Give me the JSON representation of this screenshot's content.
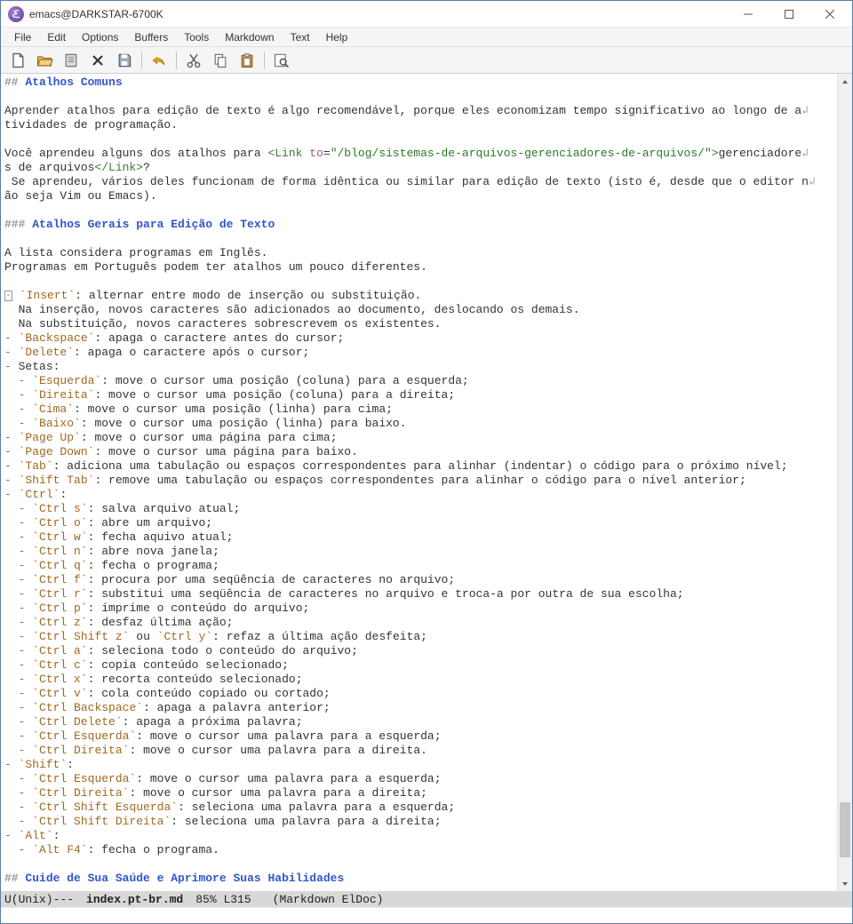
{
  "titlebar": {
    "title": "emacs@DARKSTAR-6700K"
  },
  "menubar": {
    "items": [
      "File",
      "Edit",
      "Options",
      "Buffers",
      "Tools",
      "Markdown",
      "Text",
      "Help"
    ]
  },
  "toolbar": {
    "buttons": [
      "new-file",
      "open-file",
      "open-dir",
      "close",
      "save",
      "sep",
      "undo",
      "sep",
      "cut",
      "copy",
      "paste",
      "sep",
      "search"
    ]
  },
  "modeline": {
    "coding": "U(Unix)---",
    "filename": "index.pt-br.md",
    "position": "85% L315",
    "mode": "(Markdown ElDoc)"
  },
  "doc": {
    "h1_hash": "##",
    "h1_text": "Atalhos Comuns",
    "p1a": "Aprender atalhos para edição de texto é algo recomendável, porque eles economizam tempo significativo ao longo de a",
    "p1b": "tividades de programação.",
    "p2_pre": "Você aprendeu alguns dos atalhos para ",
    "p2_tag_open": "<Link",
    "p2_attr_name": " to",
    "p2_eq": "=",
    "p2_attr_val": "\"/blog/sistemas-de-arquivos-gerenciadores-de-arquivos/\"",
    "p2_tag_close": ">",
    "p2_linktext": "gerenciadore",
    "p2b_pre": "s de arquivos",
    "p2b_tag": "</Link>",
    "p2b_post": "?",
    "p3a": " Se aprendeu, vários deles funcionam de forma idêntica ou similar para edição de texto (isto é, desde que o editor n",
    "p3b": "ão seja Vim ou Emacs).",
    "h2_hash": "###",
    "h2_text": "Atalhos Gerais para Edição de Texto",
    "p4": "A lista considera programas em Inglês.",
    "p5": "Programas em Português podem ter atalhos um pouco diferentes.",
    "li_insert_code": "Insert",
    "li_insert_rest": ": alternar entre modo de inserção ou substituição.",
    "li_insert_sub1": "  Na inserção, novos caracteres são adicionados ao documento, deslocando os demais.",
    "li_insert_sub2": "  Na substituição, novos caracteres sobrescrevem os existentes.",
    "li_bs_code": "Backspace",
    "li_bs_rest": ": apaga o caractere antes do cursor;",
    "li_del_code": "Delete",
    "li_del_rest": ": apaga o caractere após o cursor;",
    "li_arrows": "Setas:",
    "arrow_left_code": "Esquerda",
    "arrow_left_rest": ": move o cursor uma posição (coluna) para a esquerda;",
    "arrow_right_code": "Direita",
    "arrow_right_rest": ": move o cursor uma posição (coluna) para a direita;",
    "arrow_up_code": "Cima",
    "arrow_up_rest": ": move o cursor uma posição (linha) para cima;",
    "arrow_down_code": "Baixo",
    "arrow_down_rest": ": move o cursor uma posição (linha) para baixo.",
    "pgup_code": "Page Up",
    "pgup_rest": ": move o cursor uma página para cima;",
    "pgdn_code": "Page Down",
    "pgdn_rest": ": move o cursor uma página para baixo.",
    "tab_code": "Tab",
    "tab_rest": ": adiciona uma tabulação ou espaços correspondentes para alinhar (indentar) o código para o próximo nível;",
    "stab_code": "Shift Tab",
    "stab_rest": ": remove uma tabulação ou espaços correspondentes para alinhar o código para o nível anterior;",
    "ctrl_code": "Ctrl",
    "ctrl_rest": ":",
    "ctrl_s_code": "Ctrl s",
    "ctrl_s_rest": ": salva arquivo atual;",
    "ctrl_o_code": "Ctrl o",
    "ctrl_o_rest": ": abre um arquivo;",
    "ctrl_w_code": "Ctrl w",
    "ctrl_w_rest": ": fecha aquivo atual;",
    "ctrl_n_code": "Ctrl n",
    "ctrl_n_rest": ": abre nova janela;",
    "ctrl_q_code": "Ctrl q",
    "ctrl_q_rest": ": fecha o programa;",
    "ctrl_f_code": "Ctrl f",
    "ctrl_f_rest": ": procura por uma seqüência de caracteres no arquivo;",
    "ctrl_r_code": "Ctrl r",
    "ctrl_r_rest": ": substitui uma seqüência de caracteres no arquivo e troca-a por outra de sua escolha;",
    "ctrl_p_code": "Ctrl p",
    "ctrl_p_rest": ": imprime o conteúdo do arquivo;",
    "ctrl_z_code": "Ctrl z",
    "ctrl_z_rest": ": desfaz última ação;",
    "ctrl_sz_code": "Ctrl Shift z",
    "ctrl_sz_mid": " ou ",
    "ctrl_y_code": "Ctrl y",
    "ctrl_sz_rest": ": refaz a última ação desfeita;",
    "ctrl_a_code": "Ctrl a",
    "ctrl_a_rest": ": seleciona todo o conteúdo do arquivo;",
    "ctrl_c_code": "Ctrl c",
    "ctrl_c_rest": ": copia conteúdo selecionado;",
    "ctrl_x_code": "Ctrl x",
    "ctrl_x_rest": ": recorta conteúdo selecionado;",
    "ctrl_v_code": "Ctrl v",
    "ctrl_v_rest": ": cola conteúdo copiado ou cortado;",
    "ctrl_bs_code": "Ctrl Backspace",
    "ctrl_bs_rest": ": apaga a palavra anterior;",
    "ctrl_dl_code": "Ctrl Delete",
    "ctrl_dl_rest": ": apaga a próxima palavra;",
    "ctrl_left_code": "Ctrl Esquerda",
    "ctrl_left_rest": ": move o cursor uma palavra para a esquerda;",
    "ctrl_right_code": "Ctrl Direita",
    "ctrl_right_rest": ": move o cursor uma palavra para a direita.",
    "shift_code": "Shift",
    "shift_rest": ":",
    "sh_cl_code": "Ctrl Esquerda",
    "sh_cl_rest": ": move o cursor uma palavra para a esquerda;",
    "sh_cr_code": "Ctrl Direita",
    "sh_cr_rest": ": move o cursor uma palavra para a direita;",
    "sh_csl_code": "Ctrl Shift Esquerda",
    "sh_csl_rest": ": seleciona uma palavra para a esquerda;",
    "sh_csr_code": "Ctrl Shift Direita",
    "sh_csr_rest": ": seleciona uma palavra para a direita;",
    "alt_code": "Alt",
    "alt_rest": ":",
    "alt_f4_code": "Alt F4",
    "alt_f4_rest": ": fecha o programa.",
    "h3_hash": "##",
    "h3_text": "Cuide de Sua Saúde e Aprimore Suas Habilidades",
    "dash1": "- ",
    "dash2": "  - ",
    "bt": "`",
    "tail": "↲"
  }
}
